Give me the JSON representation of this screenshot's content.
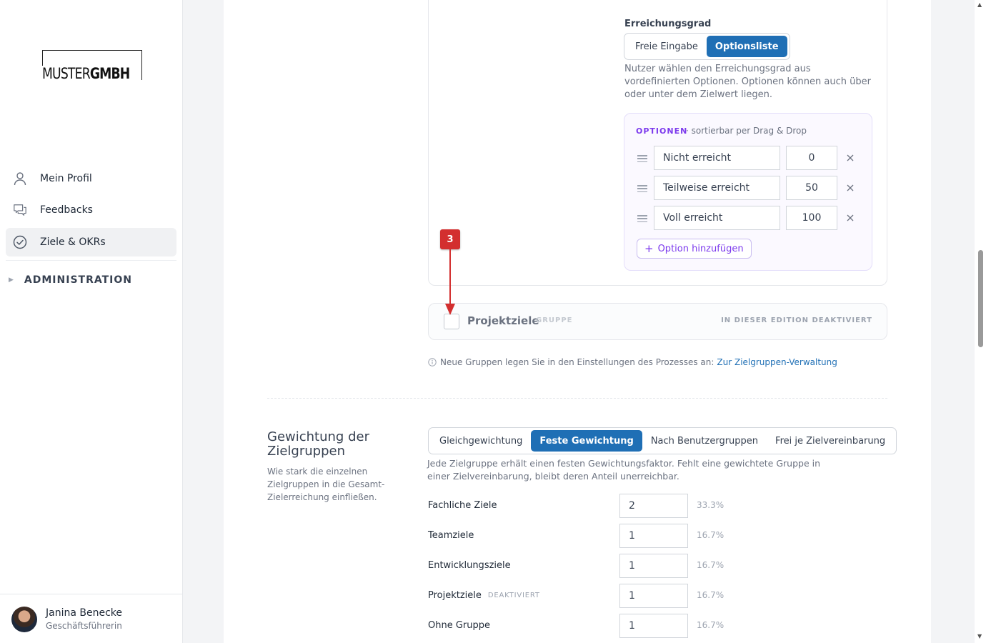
{
  "brand": {
    "logo_light": "MUSTER",
    "logo_bold": "GMBH"
  },
  "nav": {
    "items": [
      {
        "label": "Mein Profil",
        "icon": "user-icon"
      },
      {
        "label": "Feedbacks",
        "icon": "chat-bubbles-icon"
      },
      {
        "label": "Ziele & OKRs",
        "icon": "check-circle-icon",
        "active": true
      }
    ],
    "admin_label": "ADMINISTRATION"
  },
  "user": {
    "name": "Janina Benecke",
    "role": "Geschäftsführerin"
  },
  "achievement": {
    "label": "Erreichungsgrad",
    "modes": [
      "Freie Eingabe",
      "Optionsliste"
    ],
    "selected_mode": "Optionsliste",
    "hint": "Nutzer wählen den Erreichungsgrad aus vordefinierten Optionen. Optionen können auch über oder unter dem Zielwert liegen.",
    "options_title": "OPTIONEN",
    "options_subtitle": "· sortierbar per Drag & Drop",
    "options": [
      {
        "label": "Nicht erreicht",
        "value": "0"
      },
      {
        "label": "Teilweise erreicht",
        "value": "50"
      },
      {
        "label": "Voll erreicht",
        "value": "100"
      }
    ],
    "add_option_label": "Option hinzufügen"
  },
  "group": {
    "title": "Projektziele",
    "badge": "GRUPPE",
    "state": "IN DIESER EDITION DEAKTIVIERT",
    "checked": false
  },
  "info": {
    "text": "Neue Gruppen legen Sie in den Einstellungen des Prozesses an:",
    "link": "Zur Zielgruppen-Verwaltung"
  },
  "weighting": {
    "title": "Gewichtung der Zielgruppen",
    "description": "Wie stark die einzelnen Zielgruppen in die Gesamt-Zielerreichung einfließen.",
    "modes": [
      "Gleichgewichtung",
      "Feste Gewichtung",
      "Nach Benutzergruppen",
      "Frei je Zielvereinbarung"
    ],
    "selected_mode": "Feste Gewichtung",
    "hint": "Jede Zielgruppe erhält einen festen Gewichtungsfaktor. Fehlt eine gewichtete Gruppe in einer Zielvereinbarung, bleibt deren Anteil unerreichbar.",
    "rows": [
      {
        "label": "Fachliche Ziele",
        "tag": "",
        "value": "2",
        "percent": "33.3%"
      },
      {
        "label": "Teamziele",
        "tag": "",
        "value": "1",
        "percent": "16.7%"
      },
      {
        "label": "Entwicklungsziele",
        "tag": "",
        "value": "1",
        "percent": "16.7%"
      },
      {
        "label": "Projektziele",
        "tag": "DEAKTIVIERT",
        "value": "1",
        "percent": "16.7%"
      },
      {
        "label": "Ohne Gruppe",
        "tag": "",
        "value": "1",
        "percent": "16.7%"
      }
    ]
  },
  "annotation": {
    "step": "3",
    "color": "#d32f2f"
  },
  "colors": {
    "primary": "#1f6fb5",
    "accent_purple": "#7c3aed"
  }
}
